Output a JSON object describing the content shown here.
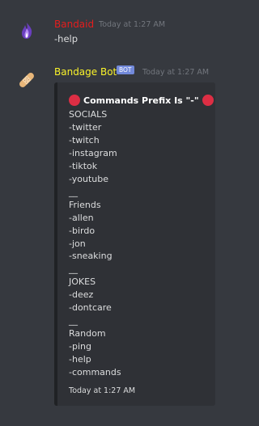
{
  "messages": [
    {
      "username": "Bandaid",
      "username_color": "#e51d1d",
      "timestamp": "Today at 1:27 AM",
      "content": "-help",
      "avatar_icon": "purple-flame-icon"
    },
    {
      "username": "Bandage Bot",
      "username_color": "#faf32a",
      "badge": "BOT",
      "timestamp": "Today at 1:27 AM",
      "avatar_icon": "bandage-icon",
      "embed": {
        "title": "Commands Prefix Is \"-\"",
        "lines": [
          "SOCIALS",
          "-twitter",
          "-twitch",
          "-instagram",
          "-tiktok",
          "-youtube",
          "__",
          "Friends",
          "-allen",
          "-birdo",
          "-jon",
          "-sneaking",
          "__",
          "JOKES",
          "-deez",
          "-dontcare",
          "__",
          "Random",
          "-ping",
          "-help",
          "-commands"
        ],
        "footer": "Today at 1:27 AM"
      }
    }
  ]
}
